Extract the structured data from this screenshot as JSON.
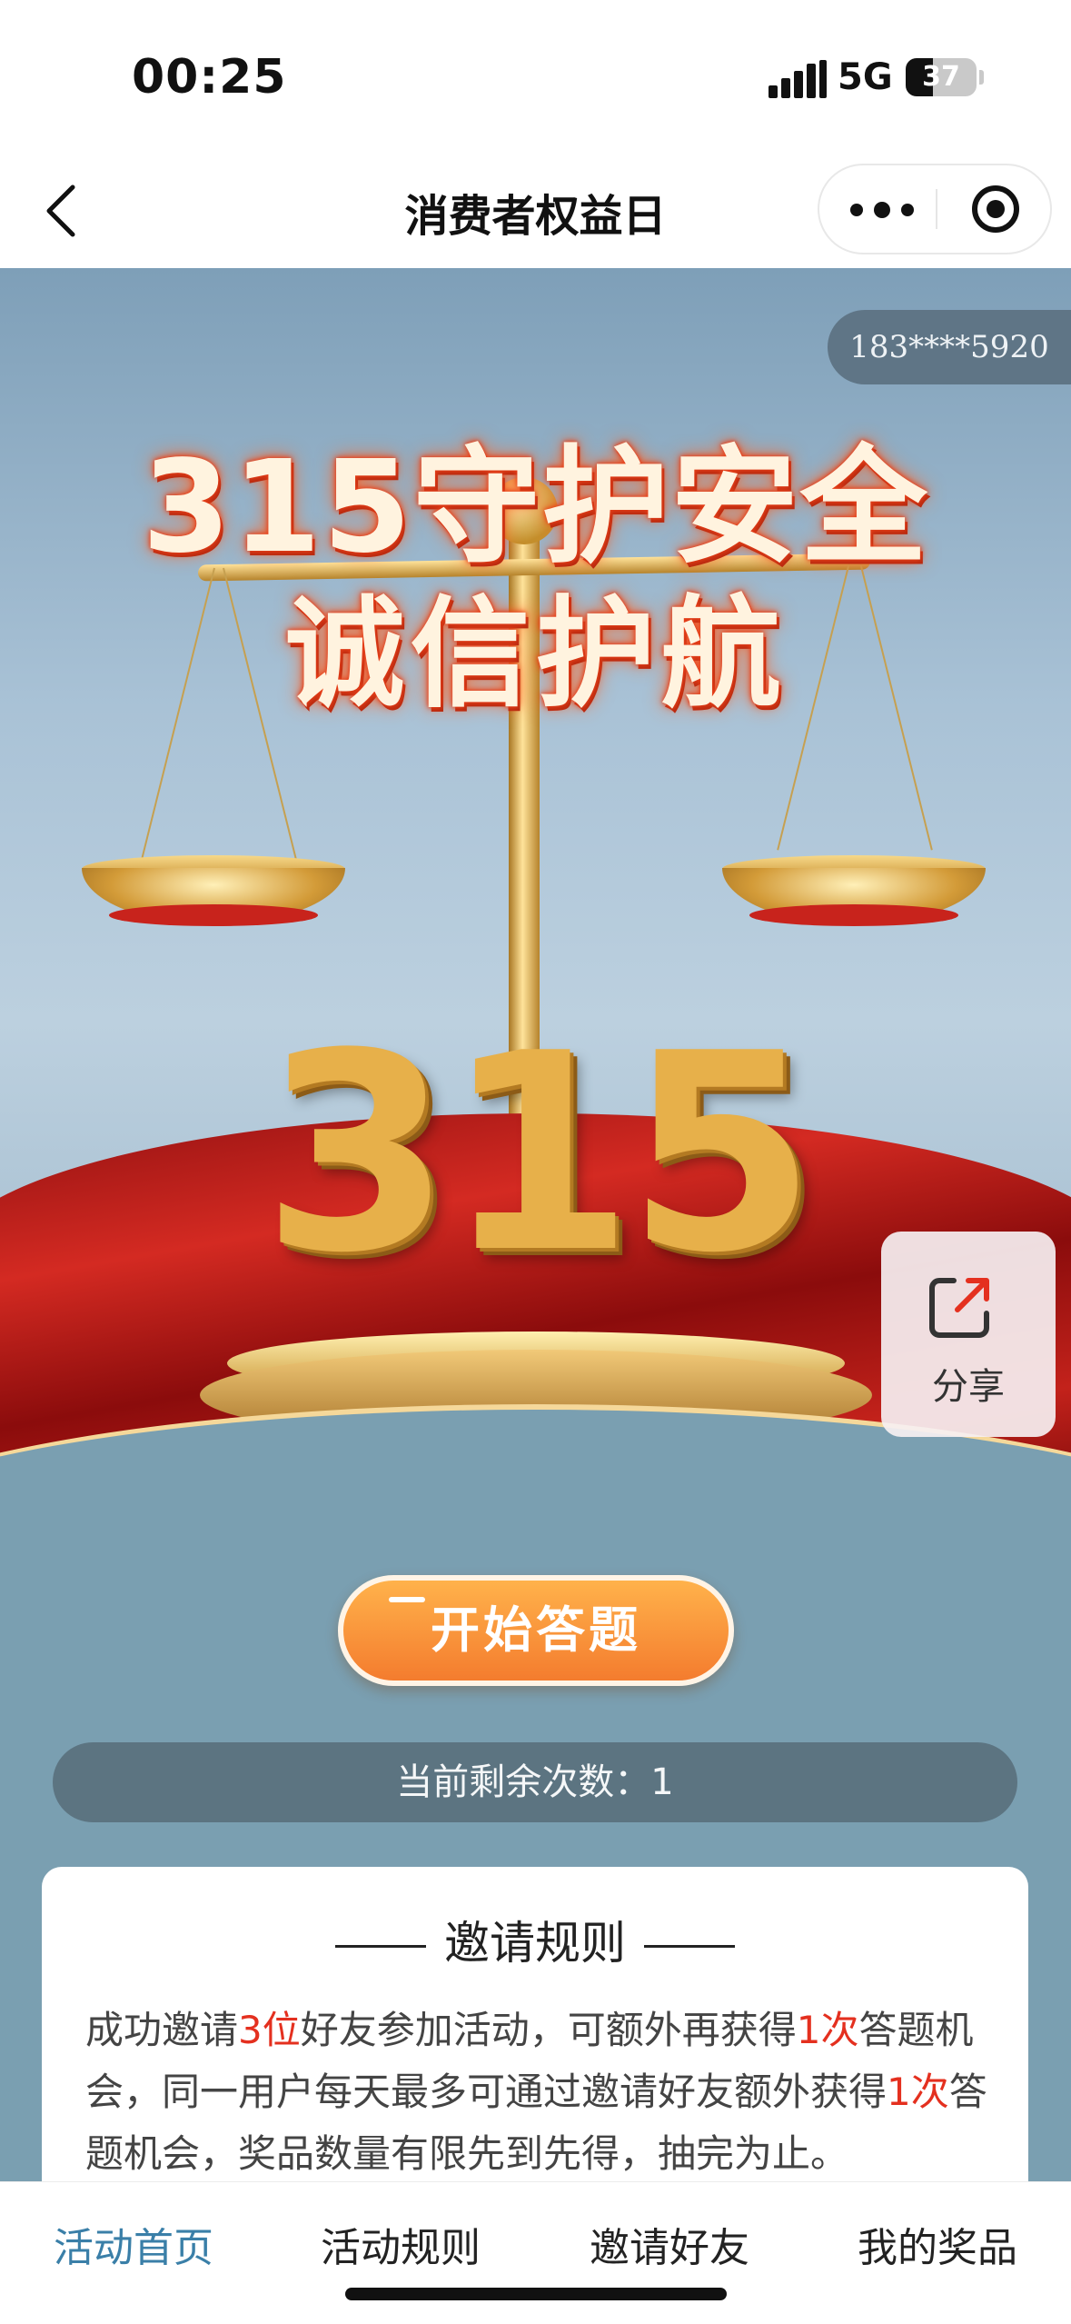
{
  "status_bar": {
    "time": "00:25",
    "network": "5G",
    "battery": "37"
  },
  "nav": {
    "title": "消费者权益日"
  },
  "hero": {
    "phone": "183****5920",
    "headline_line1": "315守护安全",
    "headline_line2": "诚信护航",
    "big_number": "315"
  },
  "share": {
    "label": "分享",
    "icon": "share-icon"
  },
  "actions": {
    "start_label": "开始答题",
    "remaining_text": "当前剩余次数：1"
  },
  "rules": {
    "title": "邀请规则",
    "text_parts": [
      "成功邀请",
      "3位",
      "好友参加活动，可额外再获得",
      "1次",
      "答题机会，同一用户每天最多可通过邀请好友额外获得",
      "1次",
      "答题机会，奖品数量有限先到先得，抽完为止。"
    ]
  },
  "tabs": [
    {
      "label": "活动首页",
      "active": true
    },
    {
      "label": "活动规则",
      "active": false
    },
    {
      "label": "邀请好友",
      "active": false
    },
    {
      "label": "我的奖品",
      "active": false
    }
  ],
  "colors": {
    "accent": "#3a7fa8",
    "highlight": "#e4301f",
    "button": "#f47c2e"
  }
}
